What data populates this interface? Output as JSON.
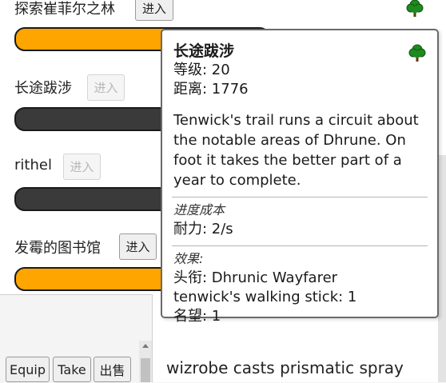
{
  "locations": [
    {
      "name": "探索崔菲尔之林",
      "enter_label": "进入",
      "enter_disabled": false,
      "bar_color": "#ffa500"
    },
    {
      "name": "长途跋涉",
      "enter_label": "进入",
      "enter_disabled": true,
      "bar_color": "#3a3a3a"
    },
    {
      "name": "rithel",
      "enter_label": "进入",
      "enter_disabled": true,
      "bar_color": "#3a3a3a"
    },
    {
      "name": "发霉的图书馆",
      "enter_label": "进入",
      "enter_disabled": false,
      "bar_color": "#ffa500"
    }
  ],
  "icons": {
    "location_type": "tree-icon",
    "tree_color": "#1f8a1f"
  },
  "tooltip": {
    "title": "长途跋涉",
    "level": "等级: 20",
    "distance": "距离: 1776",
    "description": "Tenwick's trail runs a circuit about the notable areas of Dhrune. On foot it takes the better part of a year to complete.",
    "cost_header": "进度成本",
    "cost": "耐力: 2/s",
    "effects_header": "效果:",
    "effects": [
      "头衔: Dhrunic Wayfarer",
      "tenwick's walking stick: 1",
      "名望: 1"
    ]
  },
  "bottom_buttons": {
    "equip": "Equip",
    "take": "Take",
    "sell": "出售"
  },
  "log": {
    "line": "wizrobe casts prismatic spray"
  }
}
